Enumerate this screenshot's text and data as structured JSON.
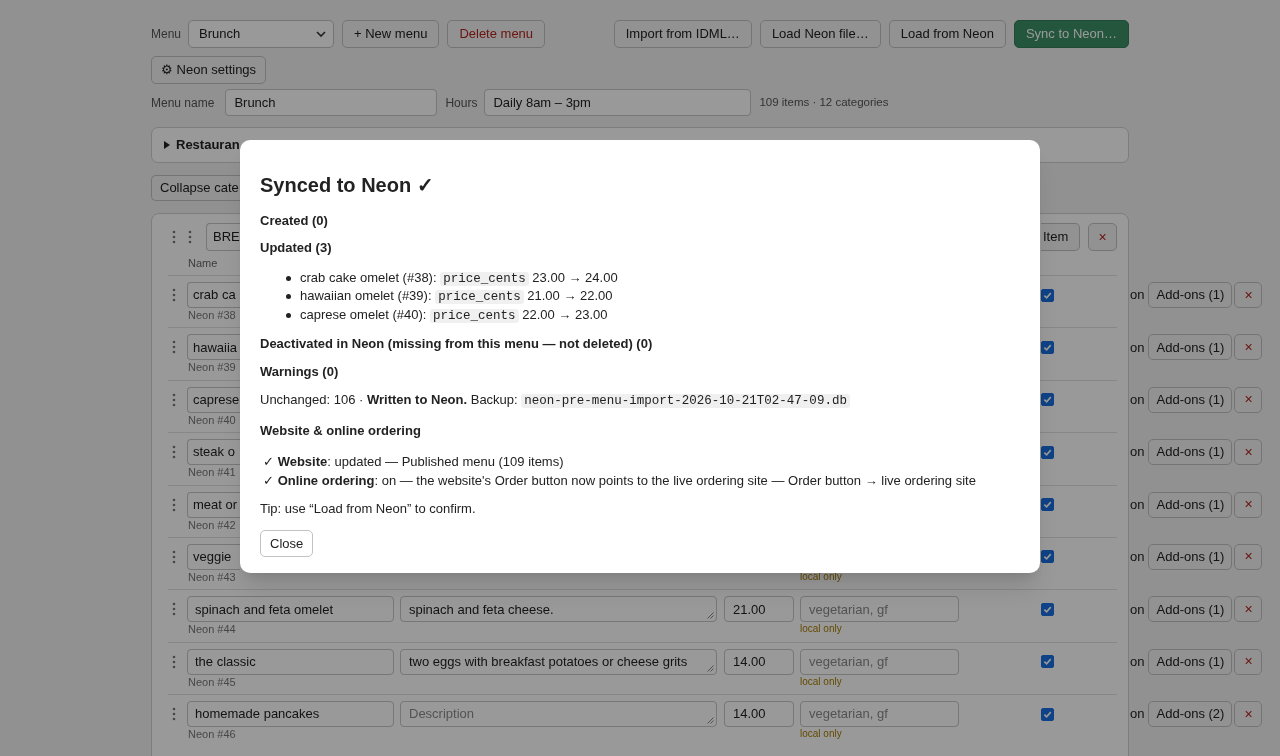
{
  "toolbar": {
    "menu_label": "Menu",
    "menu_select": "Brunch",
    "menu_buttons": [
      {
        "label": "+ New menu",
        "kind": "default"
      },
      {
        "label": "Delete menu",
        "kind": "danger"
      }
    ],
    "actions": [
      {
        "label": "Import from IDML…",
        "kind": "default"
      },
      {
        "label": "Load Neon file…",
        "kind": "default"
      },
      {
        "label": "Load from Neon",
        "kind": "default"
      },
      {
        "label": "Sync to Neon…",
        "kind": "primary"
      }
    ],
    "settings_button": "⚙ Neon settings"
  },
  "menu_details": {
    "name_label": "Menu name",
    "name": "Brunch",
    "hours_label": "Hours",
    "hours": "Daily 8am – 3pm",
    "summary": "109 items · 12 categories"
  },
  "restaurant_section": {
    "title": "Restauran",
    "expanded": false
  },
  "collapse_button": "Collapse cate",
  "category": {
    "name": "BRE",
    "add_item_button": "Item",
    "remove_button": "×",
    "column_label": "Name",
    "items": [
      {
        "name": "crab ca",
        "neon_id": "Neon #38",
        "active": true,
        "status": "on",
        "addons_button": "Add-ons (1)",
        "remove_button": "×"
      },
      {
        "name": "hawaiia",
        "neon_id": "Neon #39",
        "active": true,
        "status": "on",
        "addons_button": "Add-ons (1)",
        "remove_button": "×"
      },
      {
        "name": "caprese",
        "neon_id": "Neon #40",
        "active": true,
        "status": "on",
        "addons_button": "Add-ons (1)",
        "remove_button": "×"
      },
      {
        "name": "steak o",
        "neon_id": "Neon #41",
        "active": true,
        "status": "on",
        "addons_button": "Add-ons (1)",
        "remove_button": "×"
      },
      {
        "name": "meat or",
        "neon_id": "Neon #42",
        "active": true,
        "status": "on",
        "addons_button": "Add-ons (1)",
        "remove_button": "×"
      },
      {
        "name": "veggie",
        "neon_id": "Neon #43",
        "local_only": "local only",
        "active": true,
        "status": "on",
        "addons_button": "Add-ons (1)",
        "remove_button": "×"
      },
      {
        "name": "spinach and feta omelet",
        "neon_id": "Neon #44",
        "description": {
          "value": "spinach and feta cheese."
        },
        "price": "21.00",
        "tags": {
          "placeholder": "vegetarian, gf"
        },
        "local_only": "local only",
        "active": true,
        "status": "on",
        "addons_button": "Add-ons (1)",
        "remove_button": "×"
      },
      {
        "name": "the classic",
        "neon_id": "Neon #45",
        "description": {
          "value": "two eggs with breakfast potatoes or cheese grits"
        },
        "price": "14.00",
        "tags": {
          "placeholder": "vegetarian, gf"
        },
        "local_only": "local only",
        "active": true,
        "status": "on",
        "addons_button": "Add-ons (1)",
        "remove_button": "×"
      },
      {
        "name": "homemade pancakes",
        "neon_id": "Neon #46",
        "description": {
          "placeholder": "Description"
        },
        "price": "14.00",
        "tags": {
          "placeholder": "vegetarian, gf"
        },
        "local_only": "local only",
        "active": true,
        "status": "on",
        "addons_button": "Add-ons (2)",
        "remove_button": "×"
      }
    ]
  },
  "dialog": {
    "title": "Synced to Neon ✓",
    "created_heading": "Created (0)",
    "updated_heading": "Updated (3)",
    "updates": [
      {
        "item": "crab cake omelet (#38):",
        "field": "price_cents",
        "change": "23.00 → 24.00"
      },
      {
        "item": "hawaiian omelet (#39):",
        "field": "price_cents",
        "change": "21.00 → 22.00"
      },
      {
        "item": "caprese omelet (#40):",
        "field": "price_cents",
        "change": "22.00 → 23.00"
      }
    ],
    "deactivated_heading": "Deactivated in Neon (missing from this menu — not deleted) (0)",
    "warnings_heading": "Warnings (0)",
    "summary": "Unchanged: 106 · **Written to Neon.** Backup:",
    "backup_file": "neon-pre-menu-import-2026-10-21T02-47-09.db",
    "website_heading": "Website & online ordering",
    "website_lines": [
      "✓ **Website**: updated — Published menu (109 items)",
      "✓ **Online ordering**: on — the website's Order button now points to the live ordering site — Order button → live ordering site"
    ],
    "tip": "Tip: use “Load from Neon” to confirm.",
    "close_button": "Close"
  }
}
